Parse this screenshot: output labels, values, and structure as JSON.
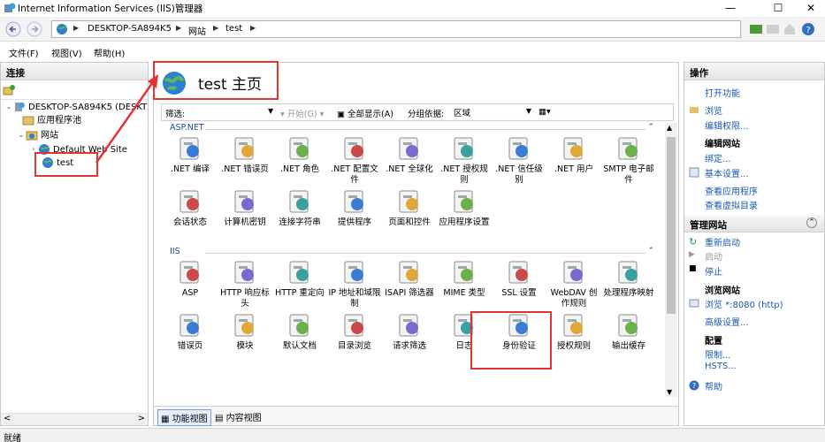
{
  "window": {
    "title": "Internet Information Services (IIS)管理器",
    "minimize": "—",
    "maximize": "☐",
    "close": "✕"
  },
  "address": {
    "crumbs": [
      "DESKTOP-SA894K5",
      "网站",
      "test"
    ]
  },
  "menu": {
    "items": [
      "文件(F)",
      "视图(V)",
      "帮助(H)"
    ]
  },
  "left": {
    "header": "连接",
    "tree": [
      {
        "label": "DESKTOP-SA894K5 (DESKT",
        "icon": "server-icon"
      },
      {
        "label": "应用程序池",
        "icon": "app-pool-icon"
      },
      {
        "label": "网站",
        "icon": "sites-folder-icon"
      },
      {
        "label": "Default Web Site",
        "icon": "globe-icon"
      },
      {
        "label": "test",
        "icon": "globe-icon"
      }
    ],
    "scroll_left": "<",
    "scroll_right": ">"
  },
  "center": {
    "title": "test 主页",
    "filter_label": "筛选:",
    "start_label": "开始(G)",
    "show_all_label": "全部显示(A)",
    "group_by_label": "分组依据:",
    "group_by_value": "区域",
    "groups": [
      {
        "name": "ASP.NET",
        "items": [
          ".NET 编译",
          ".NET 错误页",
          ".NET 角色",
          ".NET 配置文件",
          ".NET 全球化",
          ".NET 授权规则",
          ".NET 信任级别",
          ".NET 用户",
          "SMTP 电子邮件",
          "会话状态",
          "计算机密钥",
          "连接字符串",
          "提供程序",
          "页面和控件",
          "应用程序设置"
        ]
      },
      {
        "name": "IIS",
        "items": [
          "ASP",
          "HTTP 响应标头",
          "HTTP 重定向",
          "IP 地址和域限制",
          "ISAPI 筛选器",
          "MIME 类型",
          "SSL 设置",
          "WebDAV 创作规则",
          "处理程序映射",
          "错误页",
          "模块",
          "默认文档",
          "目录浏览",
          "请求筛选",
          "日志",
          "身份验证",
          "授权规则",
          "输出缓存"
        ]
      }
    ],
    "view_tabs": [
      "功能视图",
      "内容视图"
    ],
    "scroll_up": "▲",
    "scroll_down": "▼"
  },
  "right": {
    "header_actions": "操作",
    "explore": "打开功能",
    "browse": "浏览",
    "edit_permissions": "编辑权限...",
    "edit_site": "编辑网站",
    "bindings": "绑定...",
    "basic_settings": "基本设置...",
    "view_apps": "查看应用程序",
    "view_vdirs": "查看虚拟目录",
    "header_manage": "管理网站",
    "restart": "重新启动",
    "start": "启动",
    "stop": "停止",
    "browse_site": "浏览网站",
    "browse_port": "浏览 *:8080 (http)",
    "advanced": "高级设置...",
    "configure": "配置",
    "limits": "限制...",
    "hsts": "HSTS...",
    "help": "帮助"
  },
  "status": {
    "text": "就绪"
  },
  "colors": {
    "highlight": "#e23232",
    "link": "#1a5ab0"
  }
}
